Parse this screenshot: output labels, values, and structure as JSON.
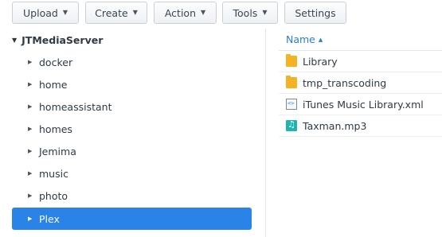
{
  "toolbar": {
    "upload": "Upload",
    "create": "Create",
    "action": "Action",
    "tools": "Tools",
    "settings": "Settings"
  },
  "tree": {
    "root": "JTMediaServer",
    "items": [
      {
        "label": "docker"
      },
      {
        "label": "home"
      },
      {
        "label": "homeassistant"
      },
      {
        "label": "homes"
      },
      {
        "label": "Jemima"
      },
      {
        "label": "music"
      },
      {
        "label": "photo"
      },
      {
        "label": "Plex",
        "selected": true
      }
    ]
  },
  "list": {
    "header": "Name",
    "rows": [
      {
        "name": "Library",
        "icon": "folder-icon"
      },
      {
        "name": "tmp_transcoding",
        "icon": "folder-icon"
      },
      {
        "name": "iTunes Music Library.xml",
        "icon": "xml-file-icon"
      },
      {
        "name": "Taxman.mp3",
        "icon": "audio-file-icon"
      }
    ]
  },
  "colors": {
    "selection": "#2a83e6",
    "folder": "#f4b225",
    "header_link": "#2a7fd6"
  }
}
